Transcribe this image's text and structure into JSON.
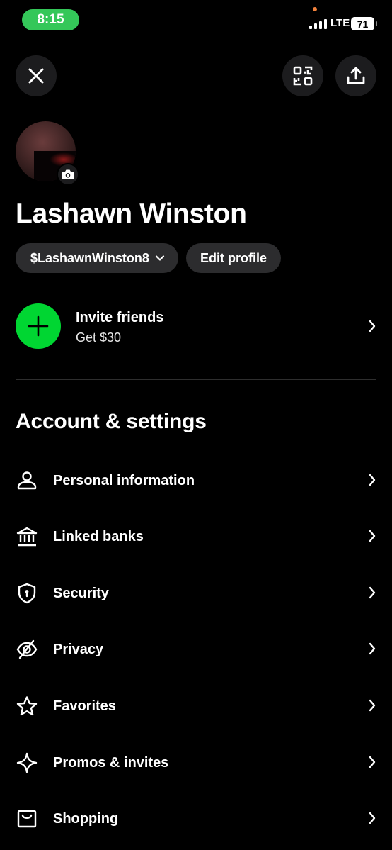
{
  "status_bar": {
    "time": "8:15",
    "network": "LTE",
    "battery": "71"
  },
  "profile": {
    "name": "Lashawn Winston",
    "cashtag": "$LashawnWinston8",
    "edit_label": "Edit profile"
  },
  "invite": {
    "title": "Invite friends",
    "subtitle": "Get $30"
  },
  "section_title": "Account & settings",
  "menu": [
    {
      "label": "Personal information",
      "icon": "person-icon"
    },
    {
      "label": "Linked banks",
      "icon": "bank-icon"
    },
    {
      "label": "Security",
      "icon": "shield-icon"
    },
    {
      "label": "Privacy",
      "icon": "eye-slash-icon"
    },
    {
      "label": "Favorites",
      "icon": "star-icon"
    },
    {
      "label": "Promos & invites",
      "icon": "sparkle-icon"
    },
    {
      "label": "Shopping",
      "icon": "shopping-bag-icon"
    }
  ],
  "colors": {
    "accent_green": "#00d632",
    "time_pill": "#34c759",
    "button_bg": "#1c1c1e",
    "pill_bg": "#2c2c2e"
  }
}
